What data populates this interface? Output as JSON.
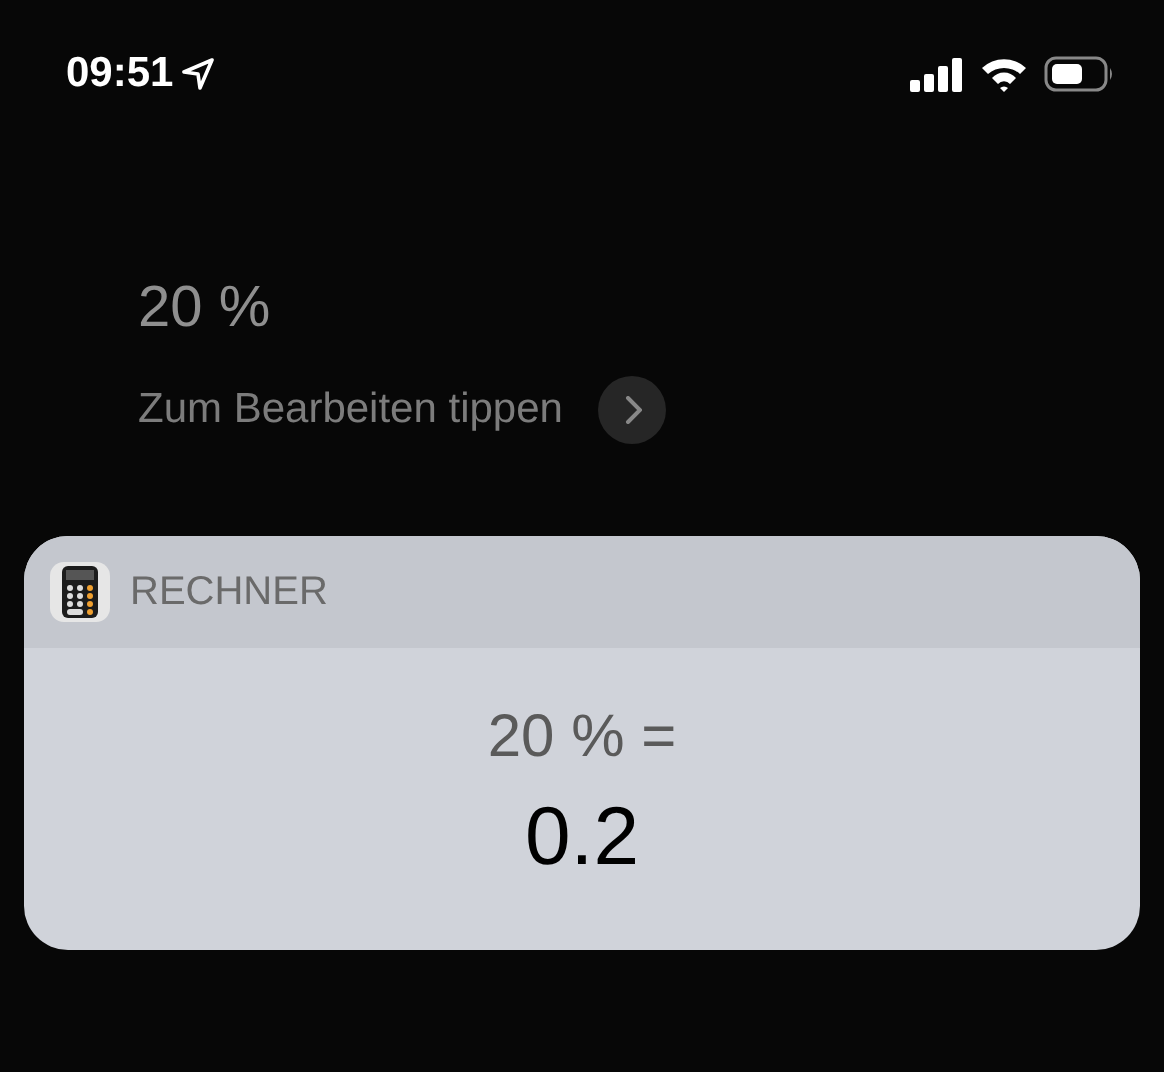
{
  "status_bar": {
    "time": "09:51"
  },
  "query": {
    "text": "20 %",
    "hint": "Zum Bearbeiten tippen"
  },
  "widget": {
    "app_name": "RECHNER",
    "expression": "20 % =",
    "result": "0.2"
  }
}
